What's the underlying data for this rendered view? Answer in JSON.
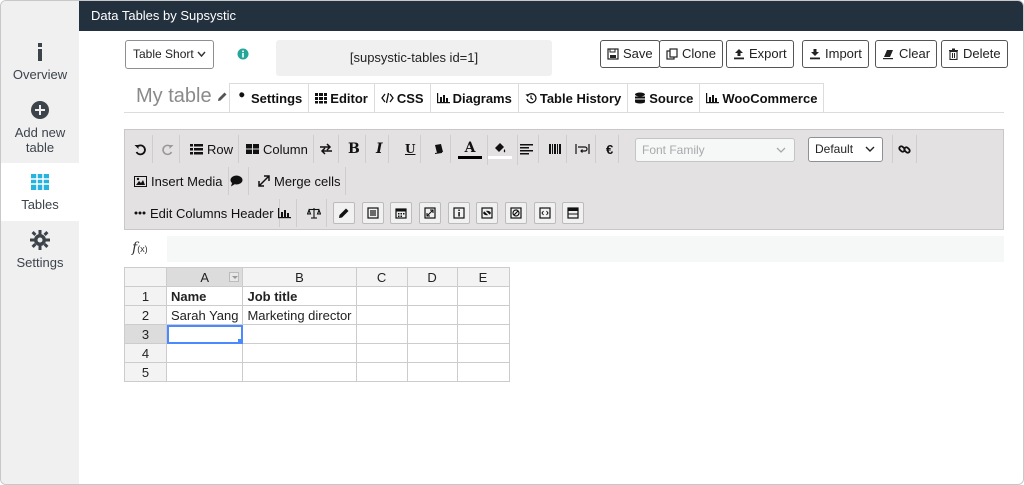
{
  "app": {
    "title": "Data Tables by Supsystic"
  },
  "sidebar": {
    "items": [
      {
        "label": "Overview",
        "icon": "info-icon"
      },
      {
        "label": "Add new table",
        "icon": "plus-circle-icon"
      },
      {
        "label": "Tables",
        "icon": "table-grid-icon",
        "active": true
      },
      {
        "label": "Settings",
        "icon": "gear-icon"
      }
    ]
  },
  "header": {
    "shortcode_select": "Table Short",
    "shortcode": "[supsystic-tables id=1]",
    "buttons": {
      "save": "Save",
      "clone": "Clone",
      "export": "Export",
      "import": "Import",
      "clear": "Clear",
      "delete": "Delete"
    }
  },
  "table_name": "My table",
  "tabs": [
    "Settings",
    "Editor",
    "CSS",
    "Diagrams",
    "Table History",
    "Source",
    "WooCommerce"
  ],
  "toolbar": {
    "row": "Row",
    "column": "Column",
    "bold": "B",
    "italic": "I",
    "underline": "U",
    "text_color": "A",
    "currency": "€",
    "font_family_placeholder": "Font Family",
    "font_size": "Default",
    "insert_media": "Insert Media",
    "merge_cells": "Merge cells",
    "edit_columns_header": "Edit Columns Header"
  },
  "formula": {
    "label": "f",
    "sub": "(x)",
    "value": ""
  },
  "grid": {
    "columns": [
      "A",
      "B",
      "C",
      "D",
      "E"
    ],
    "rows": [
      {
        "num": "1",
        "cells": [
          "Name",
          "Job title",
          "",
          "",
          ""
        ]
      },
      {
        "num": "2",
        "cells": [
          "Sarah Yang",
          "Marketing director",
          "",
          "",
          ""
        ]
      },
      {
        "num": "3",
        "cells": [
          "",
          "",
          "",
          "",
          ""
        ]
      },
      {
        "num": "4",
        "cells": [
          "",
          "",
          "",
          "",
          ""
        ]
      },
      {
        "num": "5",
        "cells": [
          "",
          "",
          "",
          "",
          ""
        ]
      }
    ]
  }
}
